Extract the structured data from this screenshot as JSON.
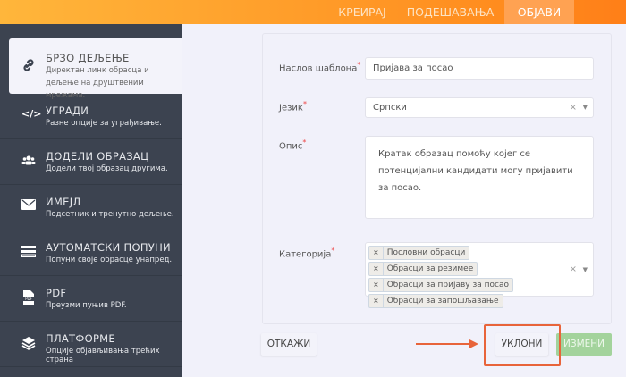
{
  "topnav": {
    "tabs": [
      {
        "label": "КРЕИРАЈ"
      },
      {
        "label": "ПОДЕШАВАЊА"
      },
      {
        "label": "ОБЈАВИ",
        "active": true
      }
    ]
  },
  "sidebar": {
    "items": [
      {
        "icon": "link-icon",
        "title": "БРЗО ДЕЉЕЊЕ",
        "desc": "Директан линк обрасца и дељење на друштвеним мрежама."
      },
      {
        "icon": "code-icon",
        "title": "УГРАДИ",
        "desc": "Разне опције за уграђивање."
      },
      {
        "icon": "users-icon",
        "title": "ДОДЕЛИ ОБРАЗАЦ",
        "desc": "Додели твој образац другима."
      },
      {
        "icon": "envelope-icon",
        "title": "ИМЕЈЛ",
        "desc": "Подсетник и тренутно дељење."
      },
      {
        "icon": "autofill-icon",
        "title": "АУТОМАТСКИ ПОПУНИ",
        "desc": "Попуни своје обрасце унапред."
      },
      {
        "icon": "pdf-icon",
        "title": "PDF",
        "desc": "Преузми пуњив PDF."
      },
      {
        "icon": "layers-icon",
        "title": "ПЛАТФОРМЕ",
        "desc": "Опције објављивања трећих страна"
      }
    ]
  },
  "form": {
    "title_label": "Наслов шаблона",
    "title_value": "Пријава за посао",
    "language_label": "Језик",
    "language_value": "Српски",
    "description_label": "Опис",
    "description_value": "Кратак образац помоћу којег се потенцијални кандидати могу пријавити за посао.",
    "category_label": "Категорија",
    "categories": [
      "Пословни обрасци",
      "Обрасци за резимее",
      "Обрасци за пријаву за посао",
      "Обрасци за запошљавање"
    ],
    "required_mark": "*",
    "clear_glyph": "×"
  },
  "actions": {
    "cancel": "ОТКАЖИ",
    "remove": "УКЛОНИ",
    "edit": "ИЗМЕНИ"
  },
  "colors": {
    "accent": "#ff8c1e",
    "highlight": "#e8643a",
    "edit_button": "#a3d39c"
  }
}
